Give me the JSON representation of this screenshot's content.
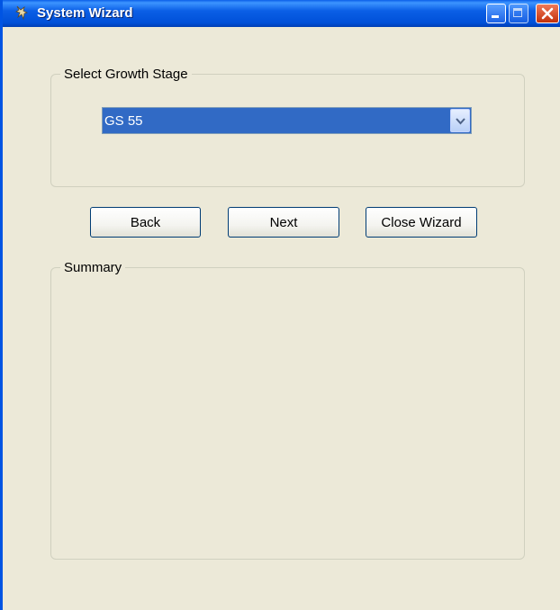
{
  "window": {
    "title": "System Wizard",
    "icon": "wizard-app-icon",
    "controls": [
      "minimize-icon",
      "maximize-icon",
      "close-icon"
    ]
  },
  "growth_stage_group": {
    "legend": "Select Growth Stage",
    "selected_value": "GS 55"
  },
  "buttons": {
    "back": "Back",
    "next": "Next",
    "close_wizard": "Close Wizard"
  },
  "summary_group": {
    "legend": "Summary",
    "content": ""
  },
  "colors": {
    "titlebar": "#0054e3",
    "window_bg": "#ece9d8",
    "selection": "#316ac5"
  }
}
